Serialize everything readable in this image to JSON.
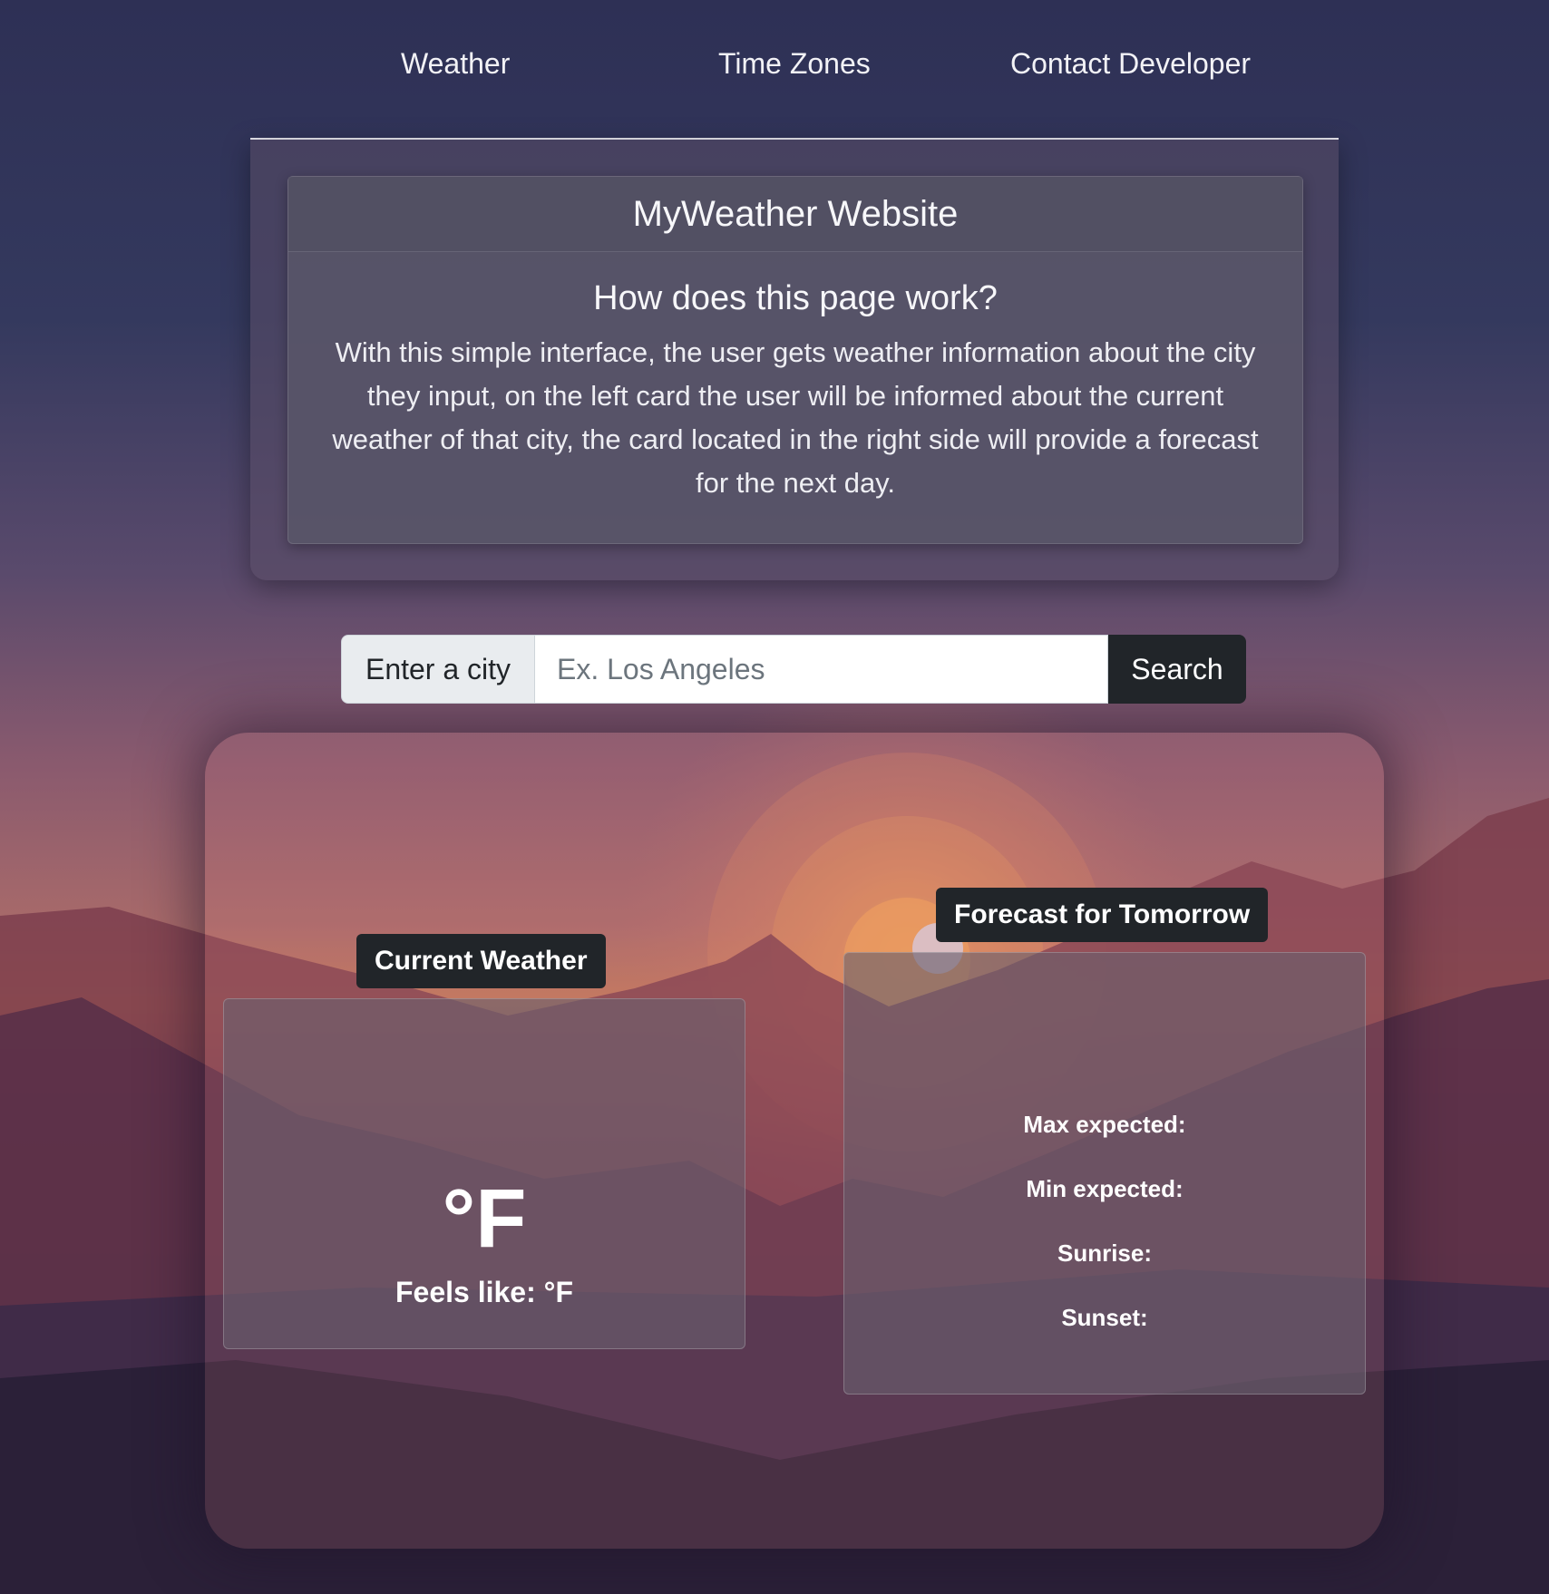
{
  "nav": {
    "links": [
      "Weather",
      "Time Zones",
      "Contact Developer"
    ]
  },
  "intro": {
    "header": "MyWeather Website",
    "title": "How does this page work?",
    "text": "With this simple interface, the user gets weather information about the city they input, on the left card the user will be informed about the current weather of that city, the card located in the right side will provide a forecast for the next day."
  },
  "search": {
    "label": "Enter a city",
    "placeholder": "Ex. Los Angeles",
    "button_label": "Search"
  },
  "current_weather": {
    "badge": "Current Weather",
    "temperature": "°F",
    "feels_like": "Feels like: °F"
  },
  "forecast": {
    "badge": "Forecast for Tomorrow",
    "max": "Max expected:",
    "min": "Min expected:",
    "sunrise": "Sunrise:",
    "sunset": "Sunset:"
  },
  "colors": {
    "nav_text": "#f2f2f6",
    "button_dark": "#212529",
    "input_addon": "#e9ecef",
    "sun": "#f0a35a"
  }
}
